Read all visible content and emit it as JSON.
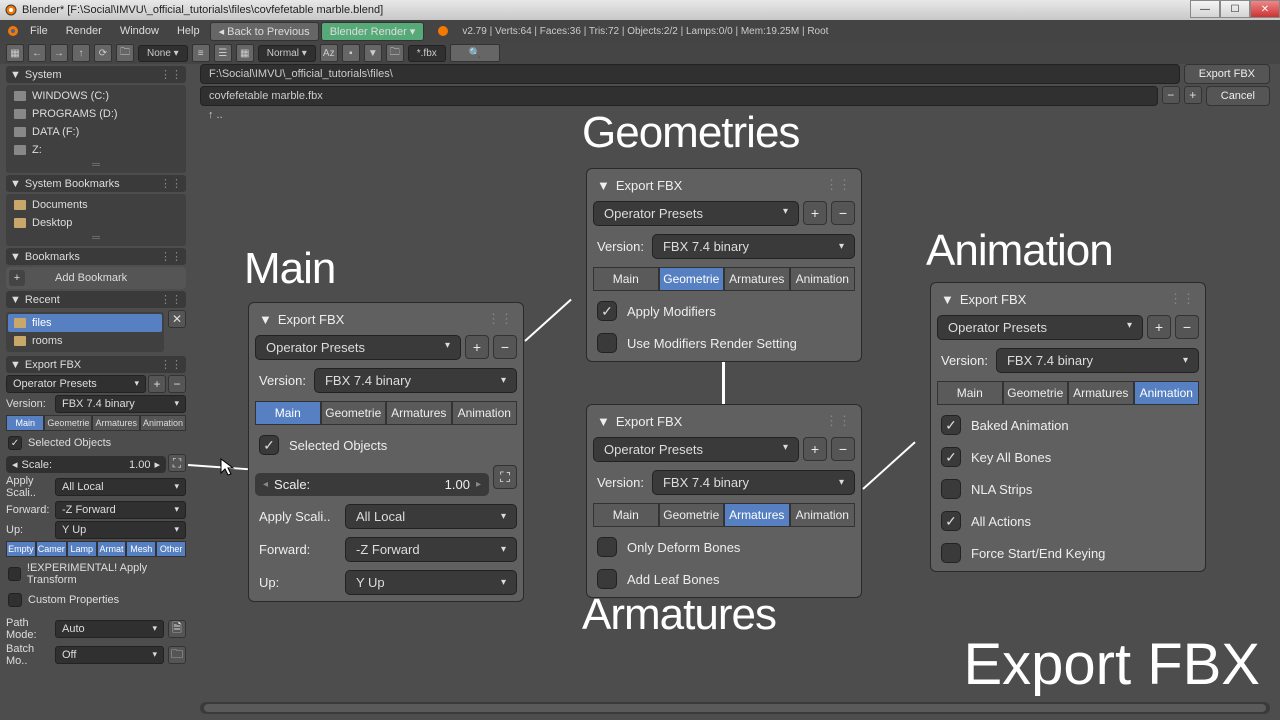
{
  "window_title": "Blender* [F:\\Social\\IMVU\\_official_tutorials\\files\\covfefetable marble.blend]",
  "menu": {
    "file": "File",
    "render": "Render",
    "window": "Window",
    "help": "Help",
    "back": "Back to Previous",
    "engine": "Blender Render"
  },
  "stats": "v2.79 | Verts:64 | Faces:36 | Tris:72 | Objects:2/2 | Lamps:0/0 | Mem:19.25M | Root",
  "toolbar": {
    "none": "None",
    "normal": "Normal",
    "filter": "*.fbx"
  },
  "path": "F:\\Social\\IMVU\\_official_tutorials\\files\\",
  "filename": "covfefetable marble.fbx",
  "export_btn": "Export FBX",
  "cancel_btn": "Cancel",
  "updir": "↑ ..",
  "side": {
    "system": "System",
    "drives": [
      "WINDOWS (C:)",
      "PROGRAMS (D:)",
      "DATA (F:)",
      "Z:"
    ],
    "sysbook": "System Bookmarks",
    "sbitems": [
      "Documents",
      "Desktop"
    ],
    "bookmarks": "Bookmarks",
    "addbm": "Add Bookmark",
    "recent": "Recent",
    "ritems": [
      "files",
      "rooms"
    ],
    "exportfbx": "Export FBX",
    "oppresets": "Operator Presets",
    "version_l": "Version:",
    "version_v": "FBX 7.4 binary",
    "tabs": [
      "Main",
      "Geometrie",
      "Armatures",
      "Animation"
    ],
    "selobj": "Selected Objects",
    "scale_l": "Scale:",
    "scale_v": "1.00",
    "apply_l": "Apply Scali..",
    "apply_v": "All Local",
    "fwd_l": "Forward:",
    "fwd_v": "-Z Forward",
    "up_l": "Up:",
    "up_v": "Y Up",
    "types": [
      "Empty",
      "Camer",
      "Lamp",
      "Armat",
      "Mesh",
      "Other"
    ],
    "exp": "!EXPERIMENTAL! Apply Transform",
    "custom": "Custom Properties",
    "pathmode_l": "Path Mode:",
    "pathmode_v": "Auto",
    "batch_l": "Batch Mo..",
    "batch_v": "Off"
  },
  "titles": {
    "main": "Main",
    "geom": "Geometries",
    "arm": "Armatures",
    "anim": "Animation",
    "big": "Export FBX"
  },
  "co_main": {
    "head": "Export FBX",
    "op": "Operator Presets",
    "ver_l": "Version:",
    "ver_v": "FBX 7.4 binary",
    "tabs": [
      "Main",
      "Geometrie",
      "Armatures",
      "Animation"
    ],
    "sel": "Selected Objects",
    "scale_l": "Scale:",
    "scale_v": "1.00",
    "apply_l": "Apply Scali..",
    "apply_v": "All Local",
    "fwd_l": "Forward:",
    "fwd_v": "-Z Forward",
    "up_l": "Up:",
    "up_v": "Y Up"
  },
  "co_geom": {
    "head": "Export FBX",
    "op": "Operator Presets",
    "ver_l": "Version:",
    "ver_v": "FBX 7.4 binary",
    "tabs": [
      "Main",
      "Geometrie",
      "Armatures",
      "Animation"
    ],
    "c1": "Apply Modifiers",
    "c2": "Use Modifiers Render Setting"
  },
  "co_arm": {
    "head": "Export FBX",
    "op": "Operator Presets",
    "ver_l": "Version:",
    "ver_v": "FBX 7.4 binary",
    "tabs": [
      "Main",
      "Geometrie",
      "Armatures",
      "Animation"
    ],
    "c1": "Only Deform Bones",
    "c2": "Add Leaf Bones"
  },
  "co_anim": {
    "head": "Export FBX",
    "op": "Operator Presets",
    "ver_l": "Version:",
    "ver_v": "FBX 7.4 binary",
    "tabs": [
      "Main",
      "Geometrie",
      "Armatures",
      "Animation"
    ],
    "c1": "Baked Animation",
    "c2": "Key All Bones",
    "c3": "NLA Strips",
    "c4": "All Actions",
    "c5": "Force Start/End Keying"
  }
}
